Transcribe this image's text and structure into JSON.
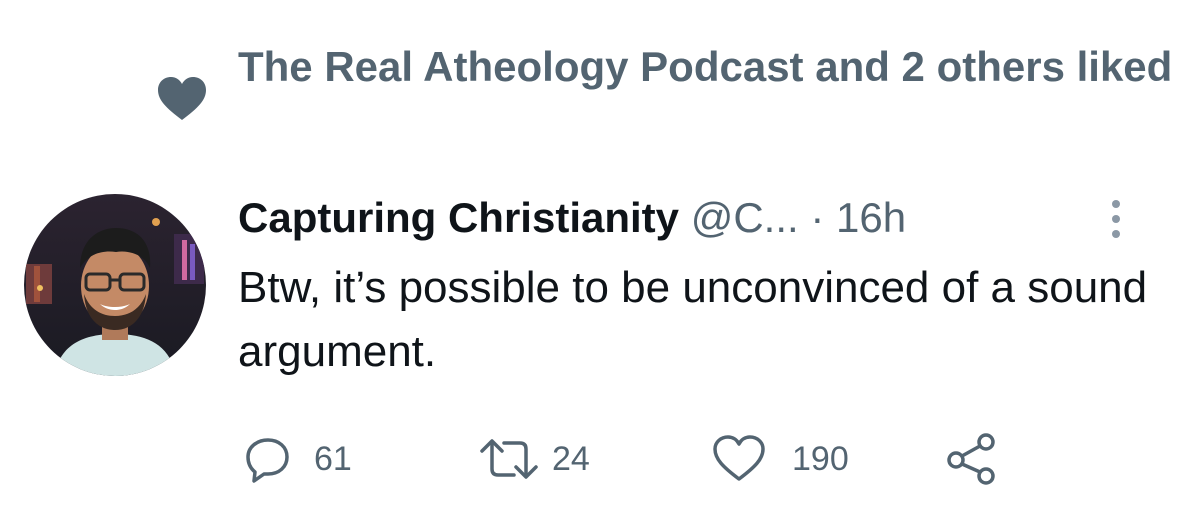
{
  "social_context": {
    "icon": "heart-filled-icon",
    "text": "The Real Atheology Podcast and 2 others liked"
  },
  "tweet": {
    "author_name": "Capturing Christianity",
    "author_handle": "@C...",
    "separator": "·",
    "timestamp": "16h",
    "text": "Btw, it’s possible to be unconvinced of a sound argument."
  },
  "actions": {
    "replies": "61",
    "retweets": "24",
    "likes": "190"
  },
  "colors": {
    "text_primary": "#0f1419",
    "text_secondary": "#536471"
  }
}
